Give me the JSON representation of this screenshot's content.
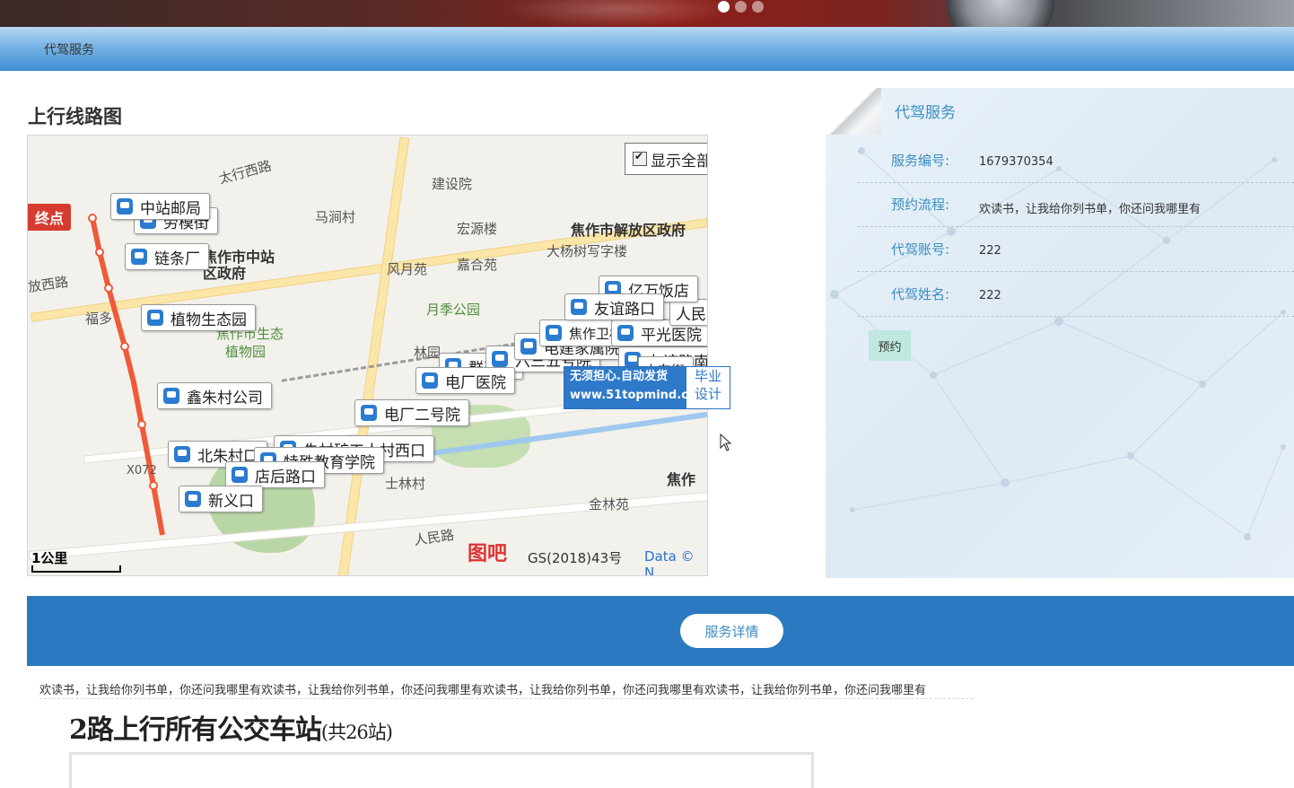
{
  "carousel": {
    "slides": 3,
    "active": 0
  },
  "nav": {
    "item": "代驾服务"
  },
  "map": {
    "title": "上行线路图",
    "end_tag": "终点",
    "show_all": "显示全部",
    "scale": "1公里",
    "copyright": "GS(2018)43号",
    "data_credit": "Data © N",
    "logo": "图吧",
    "places": {
      "p1": "太行西路",
      "p2": "马涧村",
      "p3": "建设院",
      "p4": "宏源楼",
      "p5": "焦作市解放区政府",
      "p6": "大杨树写字楼",
      "p7": "焦作市中站区政府",
      "p8": "风月苑",
      "p9": "嘉合苑",
      "p10": "月季公园",
      "p11": "放西路",
      "p12": "植物园",
      "p13": "林园",
      "p14": "福多",
      "p15": "士林村",
      "p16": "人民路",
      "p17": "金林苑",
      "p18": "焦作",
      "p19": "X072",
      "p20": "焦作市生态"
    },
    "stops": {
      "s1": "中站邮局",
      "s2": "劳模街",
      "s3": "链条厂",
      "s4": "植物生态园",
      "s5": "鑫朱村公司",
      "s6": "北朱村口",
      "s7": "店后路口",
      "s8": "新义口",
      "s9": "特殊教育学院",
      "s10": "朱村矿工人村西口",
      "s11": "电厂二号院",
      "s12": "电厂医院",
      "s13": "群英宫",
      "s14": "六三五号院",
      "s15": "电建家属院",
      "s16": "焦作卫校",
      "s17": "友谊路口",
      "s18": "亿万饭店",
      "s19": "平光医院",
      "s20": "人民",
      "s21": "友谊路南口",
      "s22": "山东街"
    },
    "watermark": {
      "line1": "无须担心.自动发货",
      "line2": "www.51topmind.com",
      "right1": "毕业",
      "right2": "设计"
    }
  },
  "card": {
    "title": "代驾服务",
    "rows": [
      {
        "label": "服务编号:",
        "value": "1679370354"
      },
      {
        "label": "预约流程:",
        "value": "欢读书，让我给你列书单，你还问我哪里有"
      },
      {
        "label": "代驾账号:",
        "value": "222"
      },
      {
        "label": "代驾姓名:",
        "value": "222"
      }
    ],
    "book_button": "预约"
  },
  "detail": {
    "button": "服务详情",
    "description": "欢读书，让我给你列书单，你还问我哪里有欢读书，让我给你列书单，你还问我哪里有欢读书，让我给你列书单，你还问我哪里有欢读书，让我给你列书单，你还问我哪里有",
    "stops_title": "2路上行所有公交车站",
    "stops_count": "(共26站)"
  },
  "colors": {
    "nav_blue": "#3f8fd3",
    "band_blue": "#2b79c0",
    "accent_text": "#3a8ec0",
    "book_btn": "#bfe8df",
    "route_red": "#f05a3a"
  }
}
